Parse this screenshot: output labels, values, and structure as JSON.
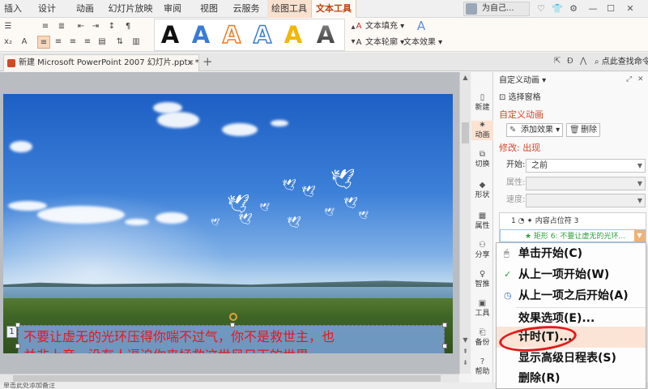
{
  "menu_tabs": [
    {
      "label": "插入"
    },
    {
      "label": "设计"
    },
    {
      "label": "动画"
    },
    {
      "label": "幻灯片放映"
    },
    {
      "label": "审阅"
    },
    {
      "label": "视图"
    },
    {
      "label": "云服务"
    },
    {
      "label": "绘图工具"
    },
    {
      "label": "文本工具"
    }
  ],
  "user": {
    "name": "为自己..."
  },
  "ribbon": {
    "wordart_sample": "A",
    "wordart_colors": [
      "#111111",
      "#3a7bd5",
      "#f07a1e",
      "#3a7bd5",
      "#f2b705",
      "#444444"
    ],
    "text_fill": "文本填充",
    "text_outline": "文本轮廓",
    "text_effect": "文本效果"
  },
  "doc_tab": {
    "title": "新建 Microsoft PowerPoint 2007 幻灯片.pptx *",
    "close": "×",
    "add": "+"
  },
  "find": {
    "label": "点此查找命令"
  },
  "slide": {
    "anim_index": "1",
    "text_lines": [
      "不要让虚无的光环压得你喘不过气，你不是救世主，也",
      "并非上帝，没有人逼迫你来拯救这世风日下的世界。"
    ]
  },
  "sidenav": [
    {
      "label": "新建",
      "icon": "new-icon"
    },
    {
      "label": "动画",
      "icon": "animation-icon"
    },
    {
      "label": "切换",
      "icon": "transition-icon"
    },
    {
      "label": "形状",
      "icon": "shape-icon"
    },
    {
      "label": "属性",
      "icon": "properties-icon"
    },
    {
      "label": "分享",
      "icon": "share-icon"
    },
    {
      "label": "智推",
      "icon": "recommend-icon"
    },
    {
      "label": "工具",
      "icon": "tools-icon"
    },
    {
      "label": "备份",
      "icon": "backup-icon"
    },
    {
      "label": "帮助",
      "icon": "help-icon"
    }
  ],
  "panel": {
    "title": "自定义动画 ▾",
    "select_pane": "选择窗格",
    "section": "自定义动画",
    "add_effect": "添加效果 ▾",
    "delete": "删除",
    "modify": "修改: 出现",
    "start_label": "开始:",
    "start_value": "之前",
    "property_label": "属性:",
    "speed_label": "速度:",
    "list": [
      {
        "label": "1 ◔ ✦ 内容占位符 3"
      },
      {
        "label": "★ 矩形 6: 不要让虚无的光环..."
      }
    ]
  },
  "context_menu": [
    {
      "label": "单击开始(C)",
      "icon": "mouse-icon"
    },
    {
      "label": "从上一项开始(W)",
      "icon": "check-icon"
    },
    {
      "label": "从上一项之后开始(A)",
      "icon": "clock-icon"
    },
    {
      "label": "效果选项(E)..."
    },
    {
      "label": "计时(T)..."
    },
    {
      "label": "显示高级日程表(S)"
    },
    {
      "label": "删除(R)"
    }
  ],
  "status": {
    "text": "单击此处添加备注"
  }
}
